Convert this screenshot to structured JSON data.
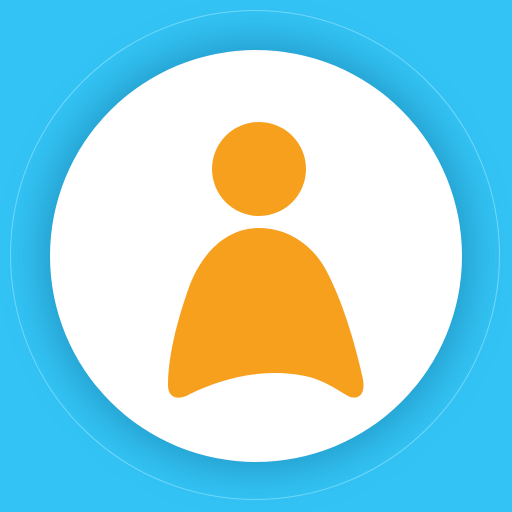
{
  "icon": {
    "name": "person-icon",
    "colors": {
      "background": "#33c4f5",
      "ring": "#7fe0ff",
      "disc": "#ffffff",
      "figure": "#f7a01e"
    }
  }
}
